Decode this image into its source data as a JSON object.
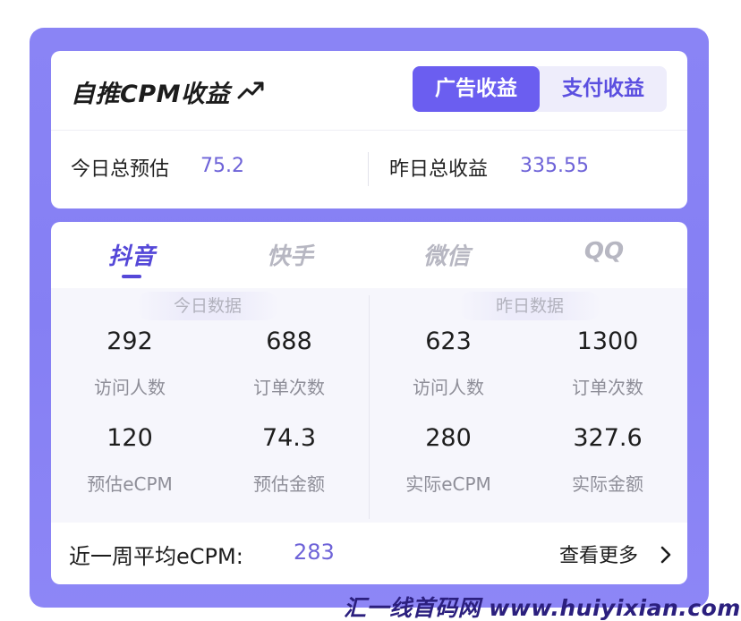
{
  "header": {
    "title": "自推CPM收益",
    "trend_icon": "trend-up-icon",
    "toggle": {
      "active_label": "广告收益",
      "inactive_label": "支付收益"
    }
  },
  "summary": {
    "today_label": "今日总预估",
    "today_value": "75.2",
    "yesterday_label": "昨日总收益",
    "yesterday_value": "335.55"
  },
  "platform_tabs": [
    {
      "label": "抖音",
      "active": true
    },
    {
      "label": "快手",
      "active": false
    },
    {
      "label": "微信",
      "active": false
    },
    {
      "label": "QQ",
      "active": false
    }
  ],
  "today": {
    "section_label": "今日数据",
    "metrics": [
      {
        "value": "292",
        "label": "访问人数"
      },
      {
        "value": "688",
        "label": "订单次数"
      },
      {
        "value": "120",
        "label": "预估eCPM"
      },
      {
        "value": "74.3",
        "label": "预估金额"
      }
    ]
  },
  "yesterday": {
    "section_label": "昨日数据",
    "metrics": [
      {
        "value": "623",
        "label": "访问人数"
      },
      {
        "value": "1300",
        "label": "订单次数"
      },
      {
        "value": "280",
        "label": "实际eCPM"
      },
      {
        "value": "327.6",
        "label": "实际金额"
      }
    ]
  },
  "footer": {
    "weekly_label": "近一周平均eCPM:",
    "weekly_value": "283",
    "more_label": "查看更多",
    "chevron_icon": "chevron-right-icon"
  },
  "watermark": "汇一线首码网 www.huiyixian.com",
  "colors": {
    "accent": "#6b5ef0",
    "tab_active": "#5548d8",
    "value_purple": "#6e63d8",
    "frame": "#8a84f5"
  }
}
